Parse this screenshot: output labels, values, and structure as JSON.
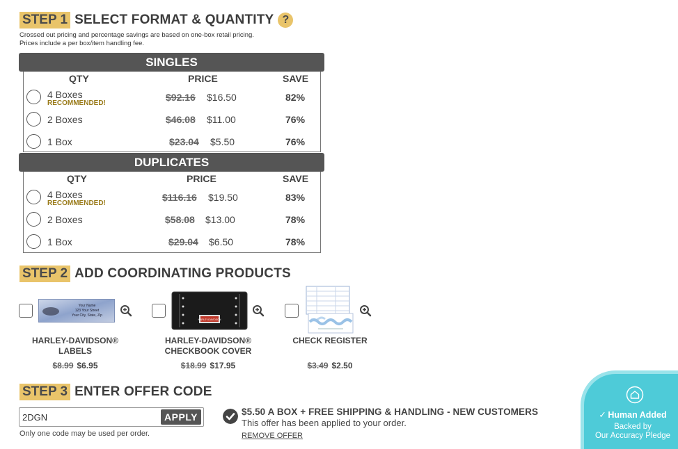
{
  "step1": {
    "tag": "STEP 1",
    "title": "SELECT FORMAT & QUANTITY",
    "help": "?",
    "note_line1": "Crossed out pricing and percentage savings are based on one-box retail pricing.",
    "note_line2": "Prices include a per box/item handling fee."
  },
  "headers": {
    "qty": "QTY",
    "price": "PRICE",
    "save": "SAVE"
  },
  "singles": {
    "title": "SINGLES",
    "rows": [
      {
        "qty": "4 Boxes",
        "recommended": "RECOMMENDED!",
        "old_price": "$92.16",
        "price": "$16.50",
        "save": "82%"
      },
      {
        "qty": "2 Boxes",
        "recommended": "",
        "old_price": "$46.08",
        "price": "$11.00",
        "save": "76%"
      },
      {
        "qty": "1 Box",
        "recommended": "",
        "old_price": "$23.04",
        "price": "$5.50",
        "save": "76%"
      }
    ]
  },
  "duplicates": {
    "title": "DUPLICATES",
    "rows": [
      {
        "qty": "4 Boxes",
        "recommended": "RECOMMENDED!",
        "old_price": "$116.16",
        "price": "$19.50",
        "save": "83%"
      },
      {
        "qty": "2 Boxes",
        "recommended": "",
        "old_price": "$58.08",
        "price": "$13.00",
        "save": "78%"
      },
      {
        "qty": "1 Box",
        "recommended": "",
        "old_price": "$29.04",
        "price": "$6.50",
        "save": "78%"
      }
    ]
  },
  "step2": {
    "tag": "STEP 2",
    "title": "ADD COORDINATING PRODUCTS",
    "products": [
      {
        "name_line1": "HARLEY-DAVIDSON®",
        "name_line2": "LABELS",
        "old_price": "$8.99",
        "price": "$6.95",
        "label_text1": "Your Name",
        "label_text2": "123 Your Street",
        "label_text3": "Your City, State, Zip"
      },
      {
        "name_line1": "HARLEY-DAVIDSON®",
        "name_line2": "CHECKBOOK COVER",
        "old_price": "$18.99",
        "price": "$17.95",
        "logo_text": "HARLEY-DAVIDSON"
      },
      {
        "name_line1": "CHECK REGISTER",
        "name_line2": "",
        "old_price": "$3.49",
        "price": "$2.50"
      }
    ]
  },
  "step3": {
    "tag": "STEP 3",
    "title": "ENTER OFFER CODE",
    "code_value": "2DGN",
    "apply_label": "APPLY",
    "code_note": "Only one code may be used per order.",
    "offer_title": "$5.50 A BOX + FREE SHIPPING & HANDLING - NEW CUSTOMERS",
    "offer_sub": "This offer has been applied to your order.",
    "remove_label": "REMOVE OFFER"
  },
  "badge": {
    "title": "Human Added",
    "sub_line1": "Backed by",
    "sub_line2": "Our Accuracy Pledge"
  },
  "colors": {
    "accent": "#e9c46a",
    "bar": "#555555",
    "badge": "#4ecbd8",
    "recommended": "#9a7b1a"
  }
}
